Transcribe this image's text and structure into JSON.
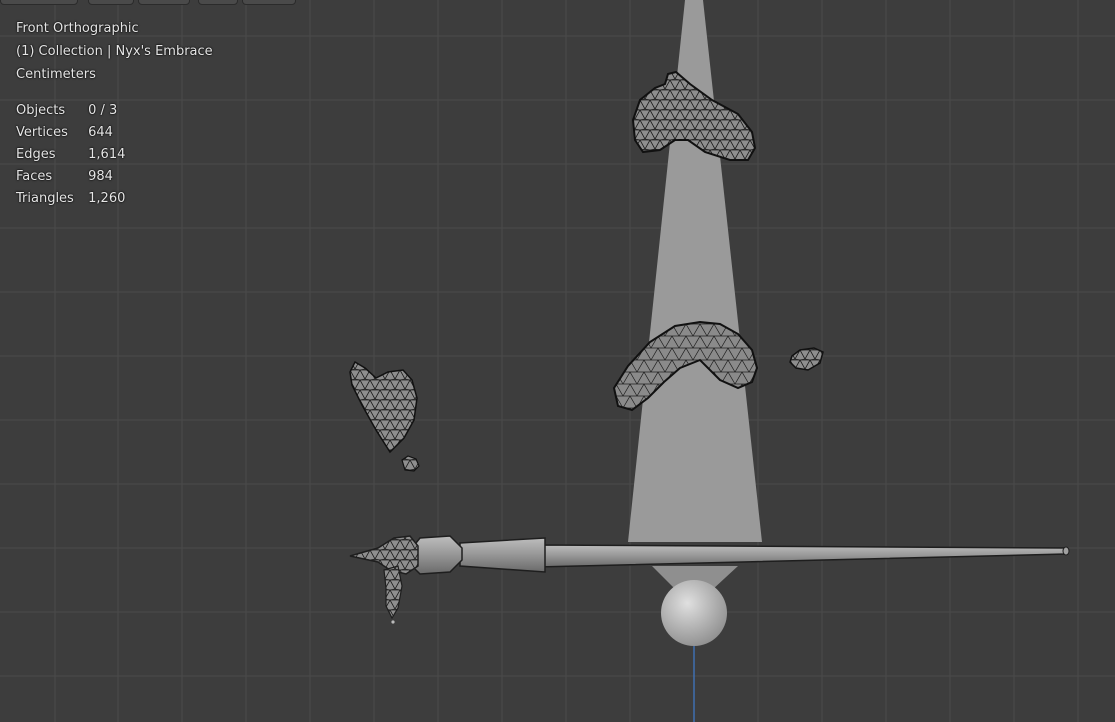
{
  "viewport": {
    "view_name": "Front Orthographic",
    "collection_line": "(1) Collection | Nyx's Embrace",
    "units": "Centimeters"
  },
  "stats": {
    "rows": [
      {
        "label": "Objects",
        "value": "0 / 3"
      },
      {
        "label": "Vertices",
        "value": "644"
      },
      {
        "label": "Edges",
        "value": "1,614"
      },
      {
        "label": "Faces",
        "value": "984"
      },
      {
        "label": "Triangles",
        "value": "1,260"
      }
    ]
  },
  "colors": {
    "background": "#3d3d3d",
    "grid": "#4a4a4a",
    "mesh_fill": "#8c8c8c",
    "wire": "#1e1e1e",
    "light_cone": "#9a9a9a",
    "axis_z": "#3f6fb0"
  }
}
